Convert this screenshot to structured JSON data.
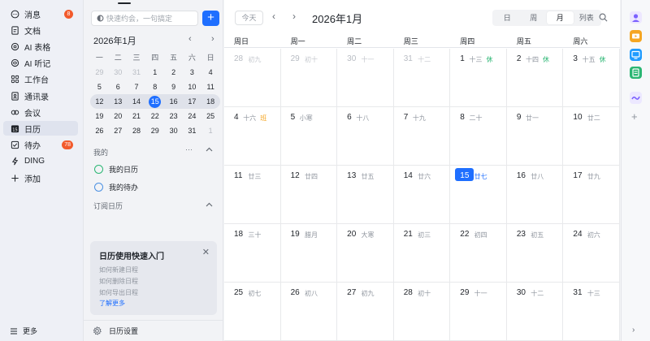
{
  "nav": {
    "items": [
      {
        "label": "消息",
        "icon": "message-icon",
        "badge": "8"
      },
      {
        "label": "文档",
        "icon": "document-icon",
        "badge": ""
      },
      {
        "label": "AI 表格",
        "icon": "ai-table-icon",
        "badge": ""
      },
      {
        "label": "AI 听记",
        "icon": "ai-minutes-icon",
        "badge": ""
      },
      {
        "label": "工作台",
        "icon": "workbench-icon",
        "badge": ""
      },
      {
        "label": "通讯录",
        "icon": "contacts-icon",
        "badge": ""
      },
      {
        "label": "会议",
        "icon": "meeting-icon",
        "badge": ""
      },
      {
        "label": "日历",
        "icon": "calendar-icon",
        "badge": "",
        "active": true
      },
      {
        "label": "待办",
        "icon": "todo-icon",
        "badge": "78"
      },
      {
        "label": "DING",
        "icon": "ding-icon",
        "badge": ""
      },
      {
        "label": "添加",
        "icon": "plus-icon",
        "badge": ""
      }
    ],
    "more_label": "更多"
  },
  "side": {
    "search_placeholder": "快速约会，一句搞定",
    "add_label": "+",
    "mini_title": "2026年1月",
    "prev": "‹",
    "next": "›",
    "weekdays": [
      "一",
      "二",
      "三",
      "四",
      "五",
      "六",
      "日"
    ],
    "weeks": [
      [
        {
          "d": "29",
          "m": true
        },
        {
          "d": "30",
          "m": true
        },
        {
          "d": "31",
          "m": true
        },
        {
          "d": "1"
        },
        {
          "d": "2"
        },
        {
          "d": "3"
        },
        {
          "d": "4"
        }
      ],
      [
        {
          "d": "5"
        },
        {
          "d": "6"
        },
        {
          "d": "7"
        },
        {
          "d": "8"
        },
        {
          "d": "9"
        },
        {
          "d": "10"
        },
        {
          "d": "11"
        }
      ],
      [
        {
          "d": "12"
        },
        {
          "d": "13"
        },
        {
          "d": "14"
        },
        {
          "d": "15",
          "t": true
        },
        {
          "d": "16"
        },
        {
          "d": "17"
        },
        {
          "d": "18"
        }
      ],
      [
        {
          "d": "19"
        },
        {
          "d": "20"
        },
        {
          "d": "21"
        },
        {
          "d": "22"
        },
        {
          "d": "23"
        },
        {
          "d": "24"
        },
        {
          "d": "25"
        }
      ],
      [
        {
          "d": "26"
        },
        {
          "d": "27"
        },
        {
          "d": "28"
        },
        {
          "d": "29"
        },
        {
          "d": "30"
        },
        {
          "d": "31"
        },
        {
          "d": "1",
          "m": true
        }
      ]
    ],
    "my_section": "我的",
    "my_more": "···",
    "my_calendars": [
      {
        "label": "我的日历",
        "color": "#2bb673"
      },
      {
        "label": "我的待办",
        "color": "#4a90e2"
      }
    ],
    "subscribed_section": "订阅日历",
    "guide": {
      "title": "日历使用快速入门",
      "links": [
        "如何新建日程",
        "如何删除日程",
        "如何导出日程"
      ],
      "more": "了解更多"
    },
    "settings_label": "日历设置"
  },
  "main": {
    "today_label": "今天",
    "prev": "‹",
    "next": "›",
    "title": "2026年1月",
    "views": [
      "日",
      "周",
      "月",
      "列表"
    ],
    "selected_view": "月",
    "weekdays": [
      "周日",
      "周一",
      "周二",
      "周三",
      "周四",
      "周五",
      "周六"
    ],
    "weeks": [
      [
        {
          "d": "28",
          "l": "初九",
          "m": true
        },
        {
          "d": "29",
          "l": "初十",
          "m": true
        },
        {
          "d": "30",
          "l": "十一",
          "m": true
        },
        {
          "d": "31",
          "l": "十二",
          "m": true
        },
        {
          "d": "1",
          "l": "十三",
          "tag": "休",
          "tc": "#2bb673"
        },
        {
          "d": "2",
          "l": "十四",
          "tag": "休",
          "tc": "#2bb673"
        },
        {
          "d": "3",
          "l": "十五",
          "tag": "休",
          "tc": "#2bb673"
        }
      ],
      [
        {
          "d": "4",
          "l": "十六",
          "tag": "班",
          "tc": "#f5a623"
        },
        {
          "d": "5",
          "l": "小寒"
        },
        {
          "d": "6",
          "l": "十八"
        },
        {
          "d": "7",
          "l": "十九"
        },
        {
          "d": "8",
          "l": "二十"
        },
        {
          "d": "9",
          "l": "廿一"
        },
        {
          "d": "10",
          "l": "廿二"
        }
      ],
      [
        {
          "d": "11",
          "l": "廿三"
        },
        {
          "d": "12",
          "l": "廿四"
        },
        {
          "d": "13",
          "l": "廿五"
        },
        {
          "d": "14",
          "l": "廿六"
        },
        {
          "d": "15",
          "l": "廿七",
          "t": true
        },
        {
          "d": "16",
          "l": "廿八"
        },
        {
          "d": "17",
          "l": "廿九"
        }
      ],
      [
        {
          "d": "18",
          "l": "三十"
        },
        {
          "d": "19",
          "l": "腊月"
        },
        {
          "d": "20",
          "l": "大寒"
        },
        {
          "d": "21",
          "l": "初三"
        },
        {
          "d": "22",
          "l": "初四"
        },
        {
          "d": "23",
          "l": "初五"
        },
        {
          "d": "24",
          "l": "初六"
        }
      ],
      [
        {
          "d": "25",
          "l": "初七"
        },
        {
          "d": "26",
          "l": "初八"
        },
        {
          "d": "27",
          "l": "初九"
        },
        {
          "d": "28",
          "l": "初十"
        },
        {
          "d": "29",
          "l": "十一"
        },
        {
          "d": "30",
          "l": "十二"
        },
        {
          "d": "31",
          "l": "十三"
        }
      ]
    ]
  },
  "rail": {
    "apps": [
      {
        "icon": "avatar-icon",
        "color": "#7b61ff"
      },
      {
        "icon": "video-app-icon",
        "color": "#f5a623"
      },
      {
        "icon": "screen-app-icon",
        "color": "#1f9bff"
      },
      {
        "icon": "list-app-icon",
        "color": "#2bb673"
      },
      {
        "icon": "wave-app-icon",
        "color": "#7b61ff"
      }
    ],
    "plus": "+",
    "collapse": "›"
  },
  "colors": {
    "accent": "#1f6fff",
    "badge": "#f25a2c"
  }
}
